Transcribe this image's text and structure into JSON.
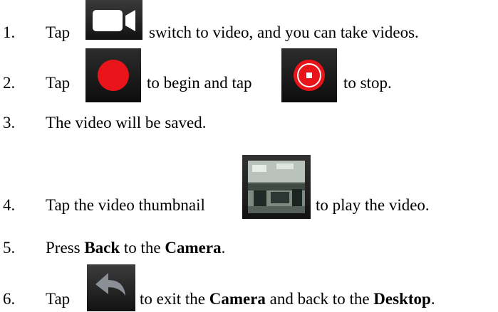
{
  "steps": [
    {
      "number": "1.",
      "parts": [
        "Tap",
        "switch to video, and you can take videos."
      ],
      "icons": [
        "video-camera-icon"
      ]
    },
    {
      "number": "2.",
      "parts": [
        "Tap",
        "to begin and tap",
        "to stop."
      ],
      "icons": [
        "record-start-icon",
        "record-stop-icon"
      ]
    },
    {
      "number": "3.",
      "parts": [
        "The video will be saved."
      ]
    },
    {
      "number": "4.",
      "parts": [
        "Tap the video thumbnail",
        "to play the video."
      ],
      "icons": [
        "video-thumbnail-icon"
      ]
    },
    {
      "number": "5.",
      "parts": [
        "Press",
        "Back",
        "to the",
        "Camera",
        "."
      ]
    },
    {
      "number": "6.",
      "parts": [
        "Tap",
        "to exit the",
        "Camera",
        "and back to the",
        "Desktop",
        "."
      ],
      "icons": [
        "back-arrow-icon"
      ]
    }
  ],
  "colors": {
    "icon_dark": "#1a1a1a",
    "record_red": "#e8141a"
  }
}
